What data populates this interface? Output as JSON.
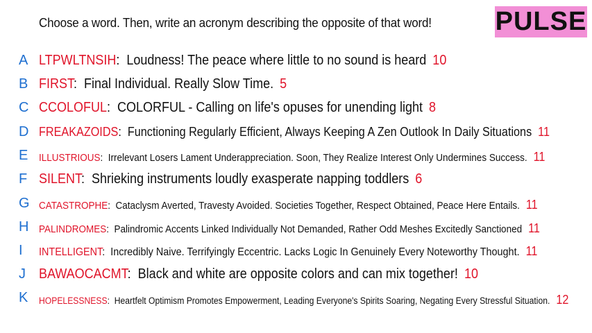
{
  "prompt": "Choose a word. Then, write an acronym describing the opposite of that word!",
  "logo": "PULSE",
  "colors": {
    "letter": "#1e6fd0",
    "word": "#e0142a",
    "score": "#e0142a",
    "logo_bg": "#f28fd6"
  },
  "entries": [
    {
      "letter": "A",
      "word": "LTPWLTNSIH",
      "definition": "Loudness! The peace where little to no sound is heard",
      "score": "10"
    },
    {
      "letter": "B",
      "word": "FIRST",
      "definition": "Final Individual. Really Slow Time.",
      "score": "5"
    },
    {
      "letter": "C",
      "word": "CCOLOFUL",
      "definition": "COLORFUL - Calling on life's opuses for unending light",
      "score": "8"
    },
    {
      "letter": "D",
      "word": "FREAKAZOIDS",
      "definition": "Functioning Regularly Efficient, Always Keeping A Zen Outlook In Daily Situations",
      "score": "11"
    },
    {
      "letter": "E",
      "word": "ILLUSTRIOUS",
      "definition": "Irrelevant Losers Lament Underappreciation. Soon, They Realize Interest Only Undermines Success.",
      "score": "11"
    },
    {
      "letter": "F",
      "word": "SILENT",
      "definition": "Shrieking instruments loudly exasperate napping toddlers",
      "score": "6"
    },
    {
      "letter": "G",
      "word": "CATASTROPHE",
      "definition": "Cataclysm Averted, Travesty Avoided. Societies Together, Respect Obtained, Peace Here Entails.",
      "score": "11"
    },
    {
      "letter": "H",
      "word": "PALINDROMES",
      "definition": "Palindromic Accents Linked Individually Not Demanded, Rather Odd Meshes Excitedly Sanctioned",
      "score": "11"
    },
    {
      "letter": "I",
      "word": "INTELLIGENT",
      "definition": "Incredibly Naive. Terrifyingly Eccentric. Lacks Logic In Genuinely Every Noteworthy Thought.",
      "score": "11"
    },
    {
      "letter": "J",
      "word": "BAWAOCACMT",
      "definition": "Black and white are opposite colors and can mix together!",
      "score": "10"
    },
    {
      "letter": "K",
      "word": "HOPELESSNESS",
      "definition": "Heartfelt Optimism Promotes Empowerment, Leading Everyone's Spirits Soaring, Negating Every Stressful Situation.",
      "score": "12"
    }
  ]
}
